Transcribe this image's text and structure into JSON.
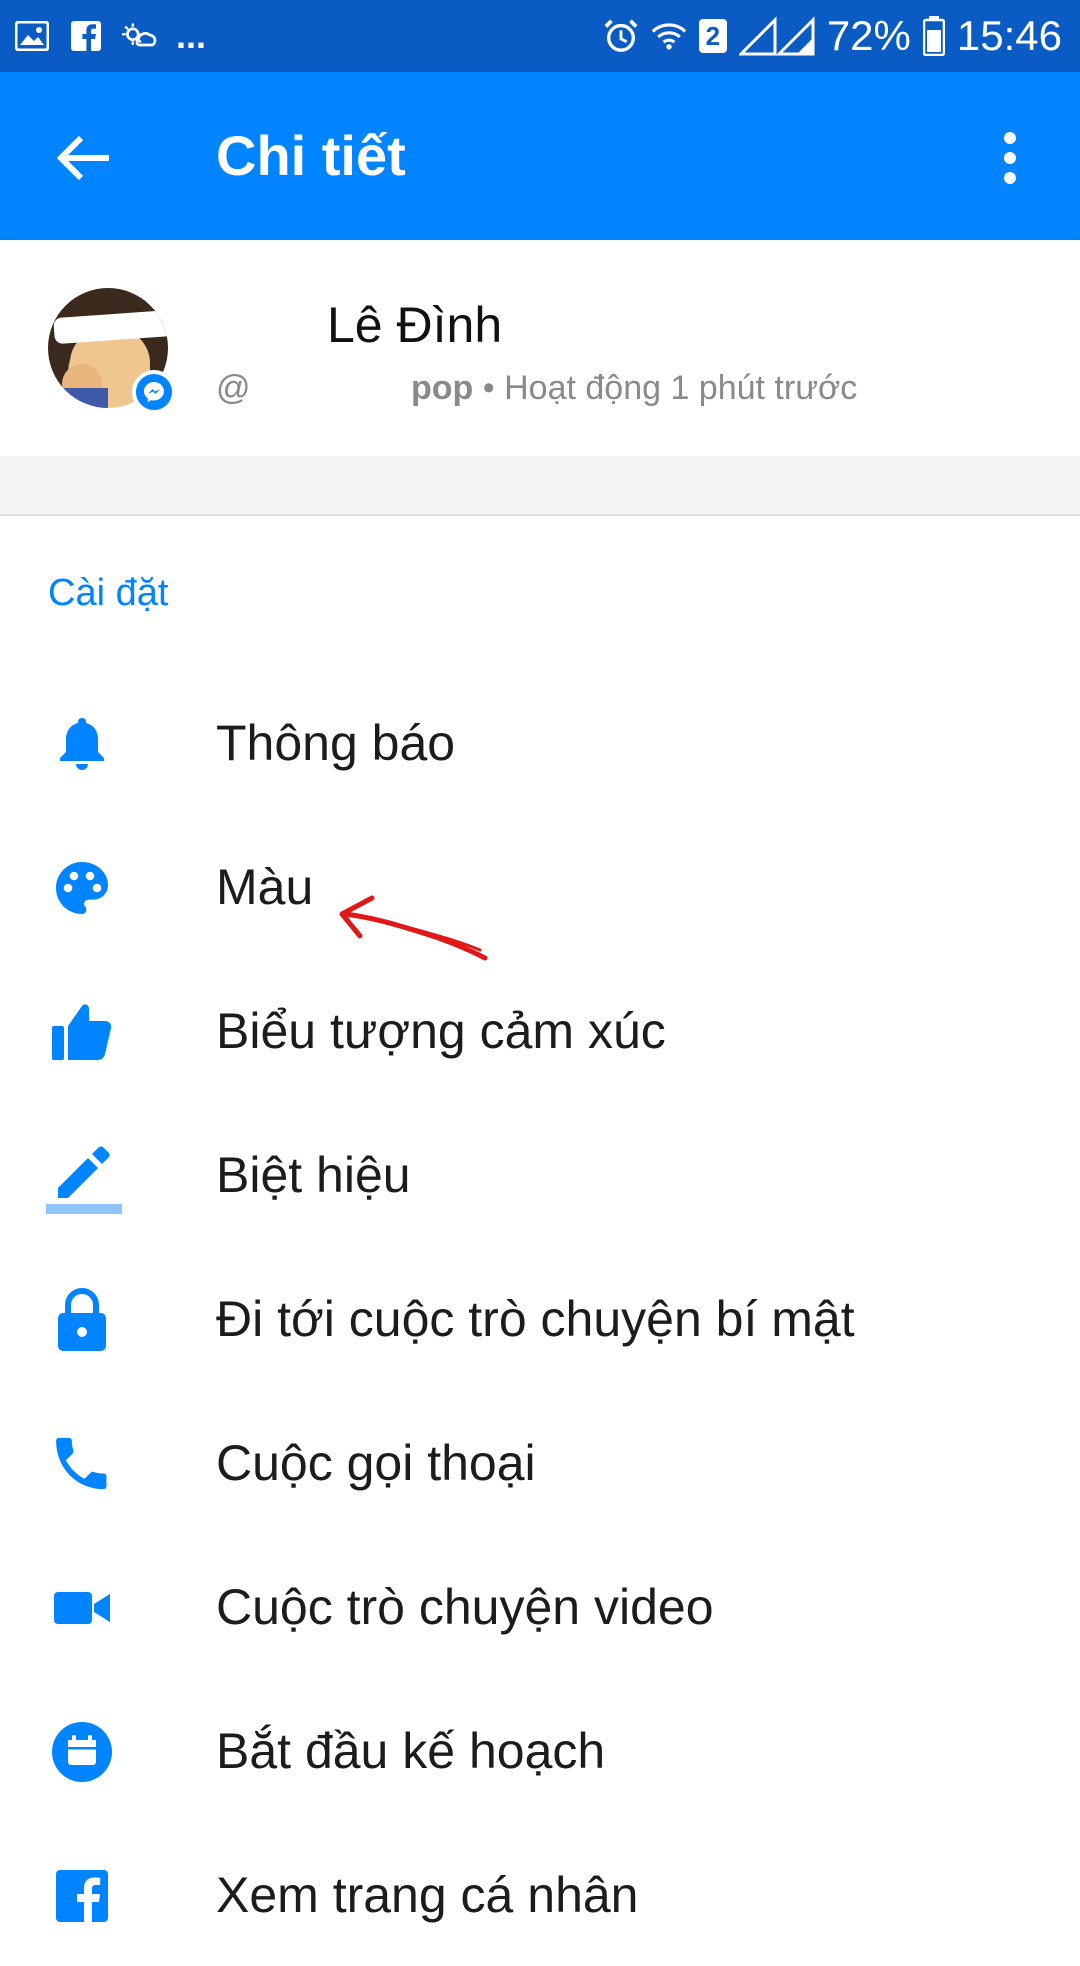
{
  "status_bar": {
    "battery": "72%",
    "time": "15:46",
    "dots": "...",
    "sim_badge": "2",
    "left_icons": [
      "image-icon",
      "facebook-icon",
      "weather-icon"
    ],
    "right_icons": [
      "alarm-icon",
      "wifi-icon",
      "signal-icon",
      "battery-icon"
    ]
  },
  "app_bar": {
    "title": "Chi tiết",
    "back_icon": "arrow-left-icon",
    "more_icon": "more-vert-icon"
  },
  "profile": {
    "name": "Lê Đình",
    "handle_prefix": "@",
    "username": "pop",
    "status": " • Hoạt động 1 phút trước"
  },
  "settings": {
    "section_title": "Cài đặt",
    "items": [
      {
        "label": "Thông báo",
        "icon": "bell-icon"
      },
      {
        "label": "Màu",
        "icon": "palette-icon"
      },
      {
        "label": "Biểu tượng cảm xúc",
        "icon": "thumbs-up-icon"
      },
      {
        "label": "Biệt hiệu",
        "icon": "pencil-icon"
      },
      {
        "label": "Đi tới cuộc trò chuyện bí mật",
        "icon": "lock-icon"
      },
      {
        "label": "Cuộc gọi thoại",
        "icon": "phone-icon"
      },
      {
        "label": "Cuộc trò chuyện video",
        "icon": "video-icon"
      },
      {
        "label": "Bắt đầu kế hoạch",
        "icon": "calendar-icon"
      },
      {
        "label": "Xem trang cá nhân",
        "icon": "facebook-icon"
      }
    ]
  },
  "colors": {
    "status_bar": "#0a5cc4",
    "app_bar": "#0084ff",
    "accent": "#0084ff",
    "annotation": "#e01818"
  }
}
